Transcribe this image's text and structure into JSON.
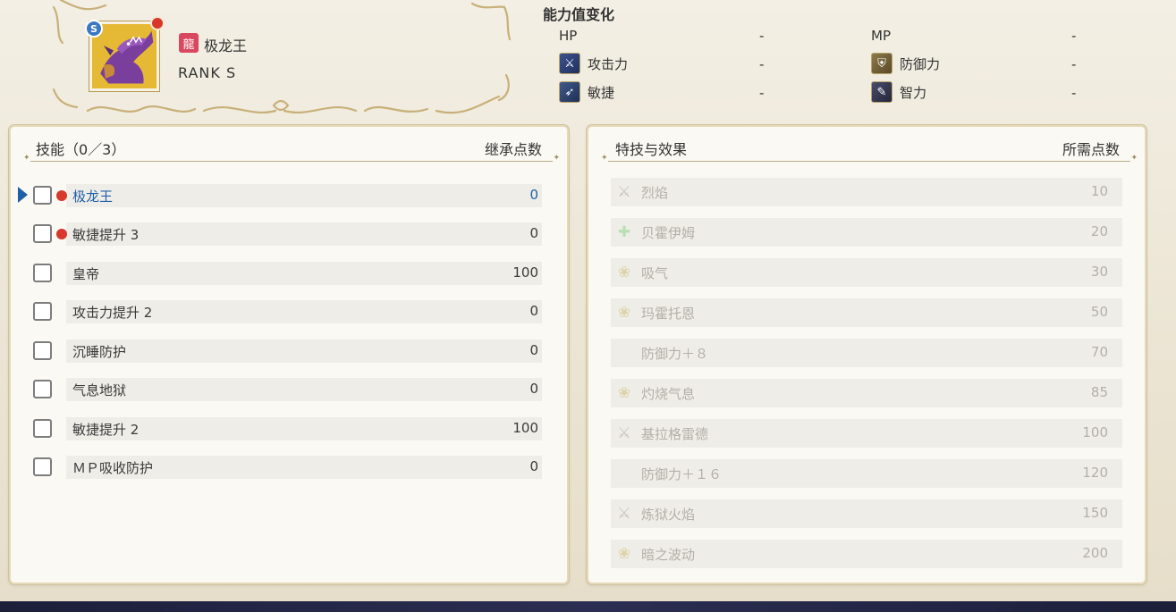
{
  "monster": {
    "name": "极龙王",
    "rank": "RANK  S",
    "rank_badge": "S",
    "type_icon": "dragon-type-icon"
  },
  "stats": {
    "title": "能力值变化",
    "hp_label": "HP",
    "hp_value": "-",
    "mp_label": "MP",
    "mp_value": "-",
    "atk_label": "攻击力",
    "atk_value": "-",
    "def_label": "防御力",
    "def_value": "-",
    "agi_label": "敏捷",
    "agi_value": "-",
    "int_label": "智力",
    "int_value": "-"
  },
  "skills_panel": {
    "title": "技能（0／3）",
    "points_header": "继承点数",
    "rows": [
      {
        "label": "极龙王",
        "points": "0"
      },
      {
        "label": "敏捷提升 3",
        "points": "0"
      },
      {
        "label": "皇帝",
        "points": "100"
      },
      {
        "label": "攻击力提升 2",
        "points": "0"
      },
      {
        "label": "沉睡防护",
        "points": "0"
      },
      {
        "label": "气息地狱",
        "points": "0"
      },
      {
        "label": "敏捷提升 2",
        "points": "100"
      },
      {
        "label": "ＭＰ吸收防护",
        "points": "0"
      }
    ]
  },
  "traits_panel": {
    "title": "特技与效果",
    "points_header": "所需点数",
    "rows": [
      {
        "label": "烈焰",
        "points": "10",
        "icon": "sword-icon"
      },
      {
        "label": "贝霍伊姆",
        "points": "20",
        "icon": "heal-cross-icon"
      },
      {
        "label": "吸气",
        "points": "30",
        "icon": "breath-icon"
      },
      {
        "label": "玛霍托恩",
        "points": "50",
        "icon": "breath-icon"
      },
      {
        "label": "防御力＋８",
        "points": "70",
        "icon": ""
      },
      {
        "label": "灼烧气息",
        "points": "85",
        "icon": "breath-icon"
      },
      {
        "label": "基拉格雷德",
        "points": "100",
        "icon": "sword-icon"
      },
      {
        "label": "防御力＋１６",
        "points": "120",
        "icon": ""
      },
      {
        "label": "炼狱火焰",
        "points": "150",
        "icon": "sword-icon"
      },
      {
        "label": "暗之波动",
        "points": "200",
        "icon": "breath-icon"
      }
    ]
  },
  "colors": {
    "selected_text": "#1f5fa8",
    "new_dot": "#d8372b",
    "disabled_text": "#b3b0a8"
  }
}
